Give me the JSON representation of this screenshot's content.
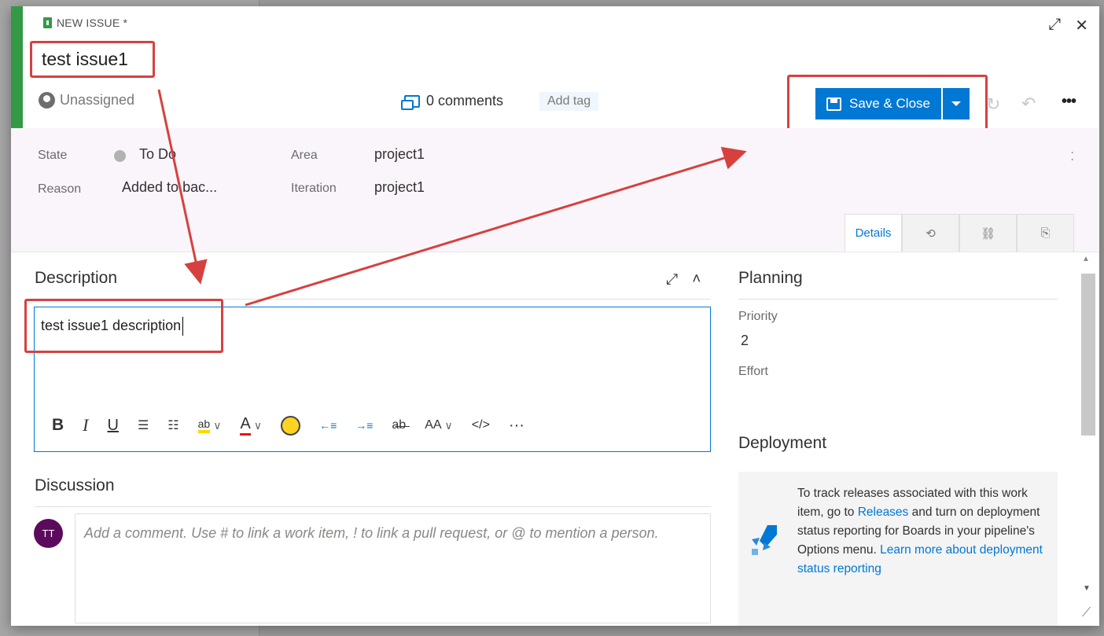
{
  "header": {
    "work_item_type": "NEW ISSUE *",
    "title": "test issue1",
    "assigned_to": "Unassigned",
    "comments": "0 comments",
    "add_tag": "Add tag",
    "save_label": "Save & Close"
  },
  "fields": {
    "state_label": "State",
    "state_value": "To Do",
    "reason_label": "Reason",
    "reason_value": "Added to bac...",
    "area_label": "Area",
    "area_value": "project1",
    "iteration_label": "Iteration",
    "iteration_value": "project1"
  },
  "tabs": [
    {
      "label": "Details",
      "icon": "details"
    },
    {
      "icon": "history-icon"
    },
    {
      "icon": "link-icon"
    },
    {
      "icon": "attachment-icon"
    }
  ],
  "description": {
    "title": "Description",
    "text": "test issue1 description"
  },
  "discussion": {
    "title": "Discussion",
    "avatar_initials": "TT",
    "placeholder": "Add a comment. Use # to link a work item, ! to link a pull request, or @ to mention a person."
  },
  "planning": {
    "title": "Planning",
    "priority_label": "Priority",
    "priority_value": "2",
    "effort_label": "Effort"
  },
  "deployment": {
    "title": "Deployment",
    "text_before": "To track releases associated with this work item, go to ",
    "releases_link": "Releases",
    "text_middle": " and turn on deployment status reporting for Boards in your pipeline's Options menu. ",
    "learn_link": "Learn more about deployment status reporting"
  },
  "colors": {
    "accent_issue": "#339947",
    "primary": "#0078d4",
    "annotation": "#d6413f"
  }
}
